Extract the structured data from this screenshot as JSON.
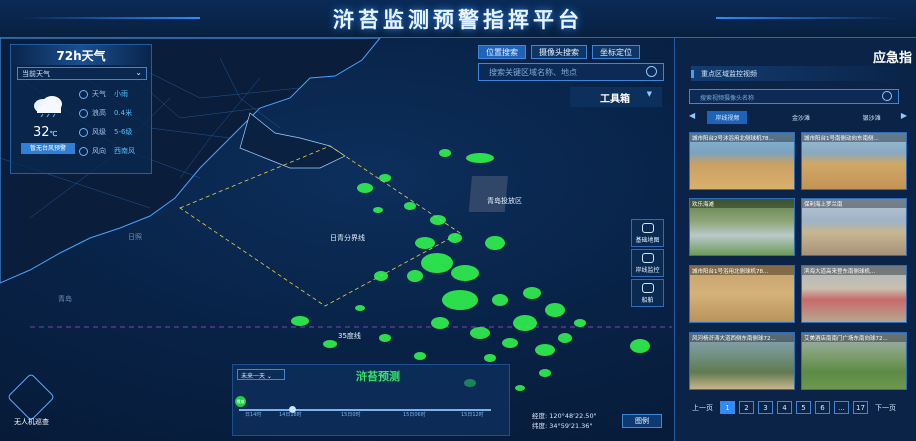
{
  "header": {
    "title": "浒苔监测预警指挥平台"
  },
  "weather": {
    "title": "72h天气",
    "select_value": "当前天气",
    "temperature": "32",
    "temp_unit": "℃",
    "badge": "暂无台风预警",
    "rows": [
      {
        "key": "天气",
        "value": "小雨"
      },
      {
        "key": "浪高",
        "value": "0.4米"
      },
      {
        "key": "风级",
        "value": "5-6级"
      },
      {
        "key": "风向",
        "value": "西南风"
      }
    ]
  },
  "search": {
    "tabs": [
      "位置搜索",
      "摄像头搜索",
      "坐标定位"
    ],
    "placeholder": "搜索关键区域名称、地点",
    "toolbox": "工具箱"
  },
  "map": {
    "labels": {
      "zone_a": "日青分界线",
      "zone_b": "青岛投放区",
      "lat_line": "35度线",
      "left_a": "日照",
      "left_b": "青岛"
    },
    "buttons": [
      "基础地图",
      "岸线监控",
      "船舶"
    ]
  },
  "timeline": {
    "select": "未来一天",
    "title": "浒苔预测",
    "play_label": "播放",
    "ticks": [
      "日14时",
      "14日18时",
      "15日0时",
      "15日06时",
      "15日12时"
    ]
  },
  "coords": {
    "lon": "经度: 120°48'22.50\"",
    "lat": "纬度: 34°59'21.36\""
  },
  "legend_button": "图例",
  "drone_label": "无人机巡查",
  "emergency": {
    "title": "应急指",
    "subtitle": "重点区域监控视频",
    "search_placeholder": "搜索视频摄像头名称",
    "tabs": [
      "岸线视频",
      "金沙滩",
      "银沙滩"
    ],
    "videos": [
      {
        "label": "城市阳台2号沐浴用北侧球机78..."
      },
      {
        "label": "城市阳台1号南侧动向东南侧..."
      },
      {
        "label": "欢乐海滩"
      },
      {
        "label": "保利海上罗兰南"
      },
      {
        "label": "城市阳台1号浴用北侧球机78..."
      },
      {
        "label": "滨海大道高来登东南侧球机..."
      },
      {
        "label": "风河杨浒涛大道西侧东南侧球72..."
      },
      {
        "label": "艾美酒店南南门广场东南向球72..."
      }
    ],
    "pager": {
      "prev": "上一页",
      "pages": [
        "1",
        "2",
        "3",
        "4",
        "5",
        "6",
        "...",
        "17"
      ],
      "next": "下一页",
      "active": "1"
    }
  }
}
